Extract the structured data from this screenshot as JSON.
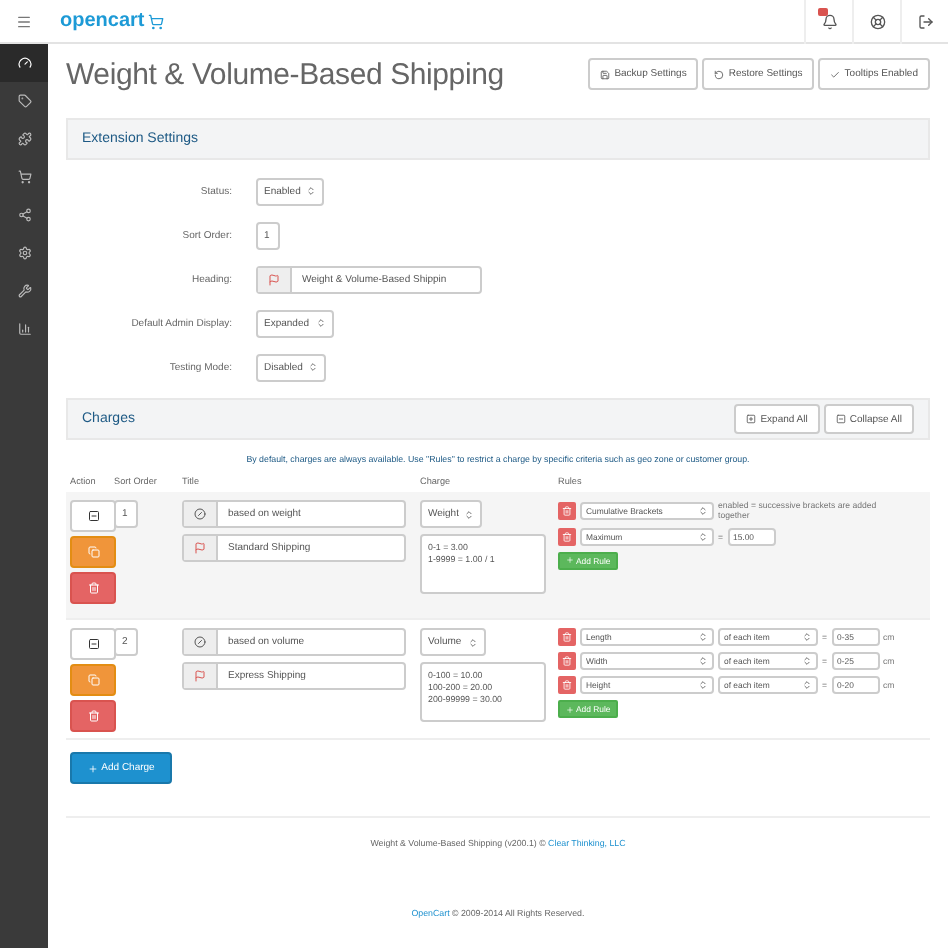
{
  "header": {
    "logo": "opencart"
  },
  "page_title": "Weight & Volume-Based Shipping",
  "toolbar_buttons": [
    {
      "kind": "backup",
      "label": "Backup Settings"
    },
    {
      "kind": "restore",
      "label": "Restore Settings"
    },
    {
      "kind": "tooltips",
      "label": "Tooltips Enabled"
    }
  ],
  "settings": {
    "title": "Extension Settings",
    "fields": [
      {
        "label": "Status:",
        "kind": "select",
        "value": "Enabled"
      },
      {
        "label": "Sort Order:",
        "kind": "text",
        "value": "1"
      },
      {
        "label": "Heading:",
        "kind": "flag_text",
        "value": "Weight & Volume-Based Shippin"
      },
      {
        "label": "Default Admin Display:",
        "kind": "select",
        "value": "Expanded"
      },
      {
        "label": "Testing Mode:",
        "kind": "select",
        "value": "Disabled"
      }
    ]
  },
  "charges": {
    "title": "Charges",
    "buttons": [
      {
        "kind": "expand",
        "label": "Expand All"
      },
      {
        "kind": "collapse",
        "label": "Collapse All"
      }
    ],
    "note": "By default, charges are always available. Use \"Rules\" to restrict a charge by specific criteria such as geo zone or customer group.",
    "columns": [
      "Action",
      "Sort Order",
      "Title",
      "Charge",
      "Rules"
    ],
    "rows": [
      {
        "highlighted": true,
        "sort_order": "1",
        "group": "based on weight",
        "title": "Standard Shipping",
        "charge_type": "Weight",
        "charge_text": "0-1 = 3.00\n1-9999 = 1.00 / 1",
        "add_rule": "Add Rule",
        "rules": [
          {
            "kind": "setting",
            "type": "Cumulative Brackets",
            "note": "enabled = successive brackets are added together"
          },
          {
            "kind": "value",
            "type": "Maximum",
            "operator": "=",
            "value": "15.00"
          }
        ]
      },
      {
        "highlighted": false,
        "sort_order": "2",
        "group": "based on volume",
        "title": "Express Shipping",
        "charge_type": "Volume",
        "charge_text": "0-100 = 10.00\n100-200 = 20.00\n200-99999 = 30.00",
        "add_rule": "Add Rule",
        "rules": [
          {
            "kind": "range",
            "type": "Length",
            "scope": "of each item",
            "operator": "=",
            "value": "0-35",
            "unit": "cm"
          },
          {
            "kind": "range",
            "type": "Width",
            "scope": "of each item",
            "operator": "=",
            "value": "0-25",
            "unit": "cm"
          },
          {
            "kind": "range",
            "type": "Height",
            "scope": "of each item",
            "operator": "=",
            "value": "0-20",
            "unit": "cm"
          }
        ]
      }
    ],
    "add_charge": "Add Charge"
  },
  "footer": {
    "credit": "Weight & Volume-Based Shipping (v200.1) © ",
    "credit_link": "Clear Thinking, LLC",
    "copyright_link": "OpenCart",
    "copyright": " © 2009-2014 All Rights Reserved."
  }
}
